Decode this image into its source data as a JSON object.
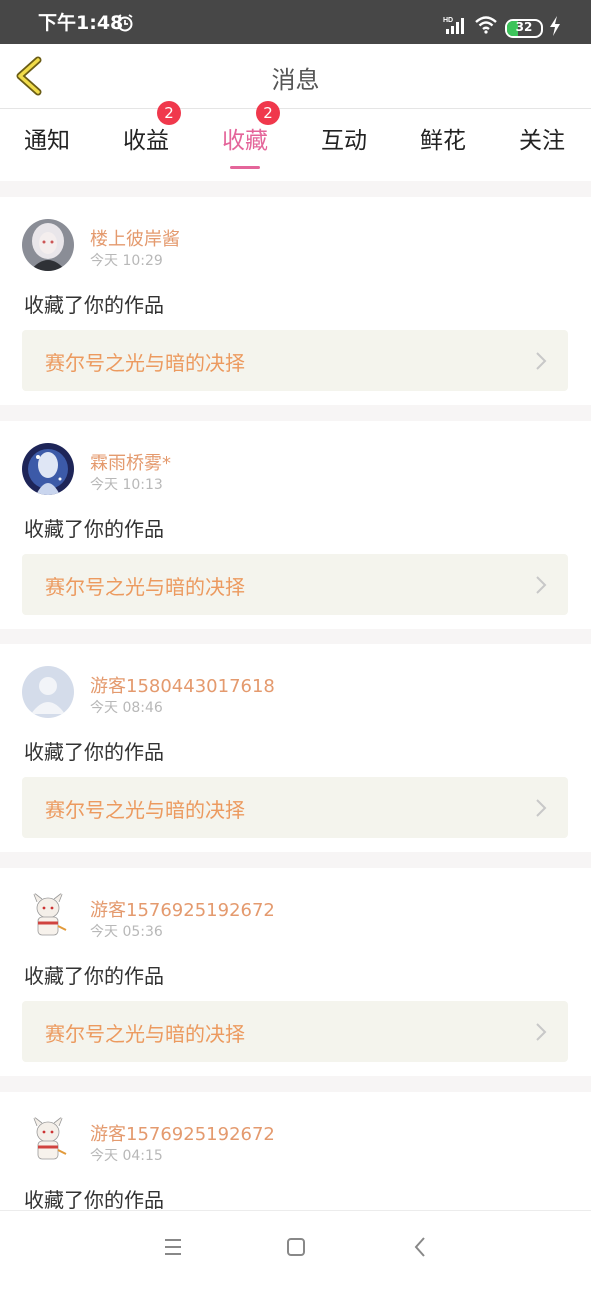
{
  "status_bar": {
    "time": "下午1:48",
    "battery": "32",
    "battery_level": 0.32,
    "icons": [
      "alarm-icon",
      "hd-signal-icon",
      "wifi-icon",
      "battery-icon",
      "charging-icon"
    ]
  },
  "header": {
    "title": "消息",
    "back_icon": "chevron-left-icon"
  },
  "tabs": [
    {
      "label": "通知",
      "active": false,
      "badge": ""
    },
    {
      "label": "收益",
      "active": false,
      "badge": "2"
    },
    {
      "label": "收藏",
      "active": true,
      "badge": "2"
    },
    {
      "label": "互动",
      "active": false,
      "badge": ""
    },
    {
      "label": "鲜花",
      "active": false,
      "badge": ""
    },
    {
      "label": "关注",
      "active": false,
      "badge": ""
    }
  ],
  "feed": [
    {
      "username": "楼上彼岸酱",
      "time": "今天 10:29",
      "action": "收藏了你的作品",
      "work": "赛尔号之光与暗的决择"
    },
    {
      "username": "霖雨桥雾*",
      "time": "今天 10:13",
      "action": "收藏了你的作品",
      "work": "赛尔号之光与暗的决择"
    },
    {
      "username": "游客1580443017618",
      "time": "今天 08:46",
      "action": "收藏了你的作品",
      "work": "赛尔号之光与暗的决择"
    },
    {
      "username": "游客1576925192672",
      "time": "今天 05:36",
      "action": "收藏了你的作品",
      "work": "赛尔号之光与暗的决择"
    },
    {
      "username": "游客1576925192672",
      "time": "今天 04:15",
      "action": "收藏了你的作品",
      "work": ""
    }
  ],
  "colors": {
    "accent": "#e4659a",
    "username": "#e49a6e",
    "work_title": "#ec9a5f",
    "badge": "#f0384c"
  },
  "nav_bar": {
    "icons": [
      "menu-icon",
      "home-icon",
      "back-icon"
    ]
  }
}
